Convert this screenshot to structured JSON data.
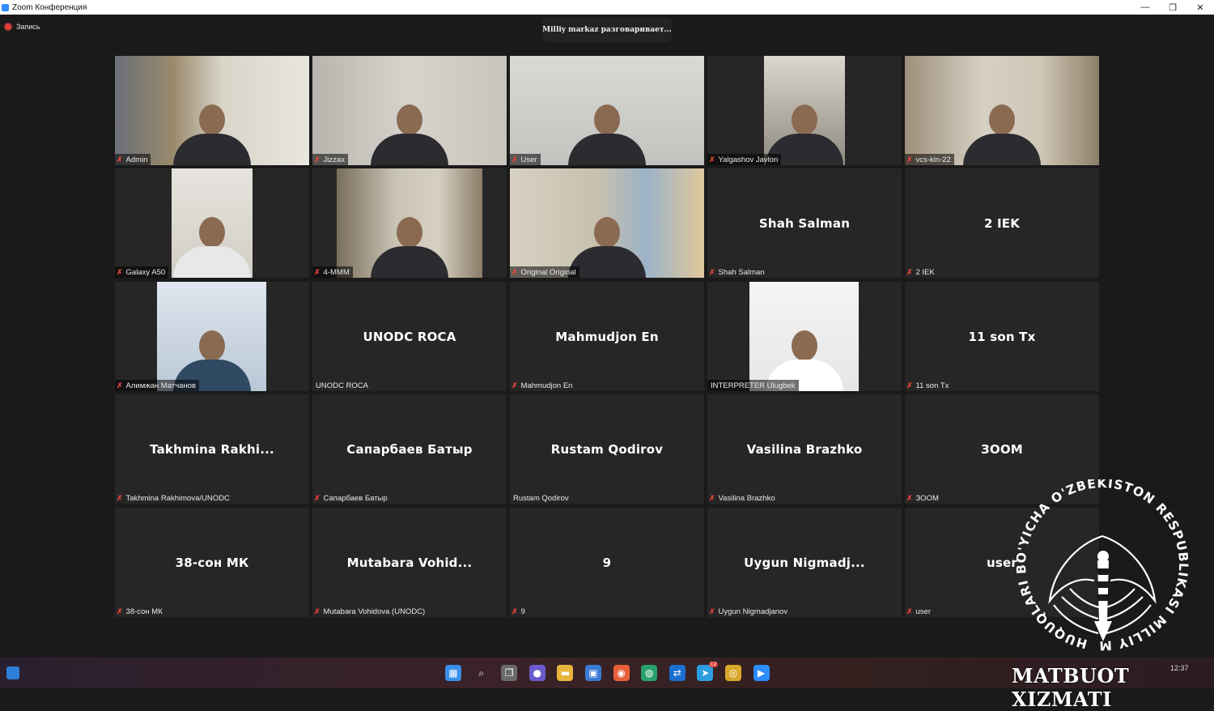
{
  "window": {
    "title": "Zoom Конференция",
    "minimize": "—",
    "restore": "❐",
    "close": "✕"
  },
  "recording": {
    "label": "Запись"
  },
  "speaking_indicator": "Milliy markaz разговаривает...",
  "tiles": [
    {
      "label": "Admin",
      "muted": true,
      "video": true,
      "center": ""
    },
    {
      "label": "Jizzax",
      "muted": true,
      "video": true,
      "center": ""
    },
    {
      "label": "User",
      "muted": true,
      "video": true,
      "center": ""
    },
    {
      "label": "Yalgashov Javlon",
      "muted": true,
      "video": true,
      "center": ""
    },
    {
      "label": "vcs-kin-22",
      "muted": true,
      "video": true,
      "center": ""
    },
    {
      "label": "Galaxy A50",
      "muted": true,
      "video": true,
      "center": ""
    },
    {
      "label": "4-MMM",
      "muted": true,
      "video": true,
      "center": ""
    },
    {
      "label": "Original Original",
      "muted": true,
      "video": true,
      "center": ""
    },
    {
      "label": "Shah Salman",
      "muted": true,
      "video": false,
      "center": "Shah Salman"
    },
    {
      "label": "2 IEK",
      "muted": true,
      "video": false,
      "center": "2 IEK"
    },
    {
      "label": "Алимжан Матчанов",
      "muted": true,
      "video": true,
      "center": ""
    },
    {
      "label": "UNODC ROCA",
      "muted": false,
      "video": false,
      "center": "UNODC ROCA"
    },
    {
      "label": "Mahmudjon En",
      "muted": true,
      "video": false,
      "center": "Mahmudjon En"
    },
    {
      "label": "INTERPRETER Ulugbek",
      "muted": false,
      "video": true,
      "center": ""
    },
    {
      "label": "11 son Tx",
      "muted": true,
      "video": false,
      "center": "11 son Tx"
    },
    {
      "label": "Takhmina Rakhimova/UNODC",
      "muted": true,
      "video": false,
      "center": "Takhmina  Rakhi..."
    },
    {
      "label": "Сапарбаев Батыр",
      "muted": true,
      "video": false,
      "center": "Сапарбаев Батыр"
    },
    {
      "label": "Rustam Qodirov",
      "muted": false,
      "video": false,
      "center": "Rustam Qodirov"
    },
    {
      "label": "Vasilina Brazhko",
      "muted": true,
      "video": false,
      "center": "Vasilina Brazhko"
    },
    {
      "label": "ЗООМ",
      "muted": true,
      "video": false,
      "center": "ЗООМ"
    },
    {
      "label": "38-сон МК",
      "muted": true,
      "video": false,
      "center": "38-сон МК"
    },
    {
      "label": "Mutabara Vohidova (UNODC)",
      "muted": true,
      "video": false,
      "center": "Mutabara  Vohid..."
    },
    {
      "label": "9",
      "muted": true,
      "video": false,
      "center": "9"
    },
    {
      "label": "Uygun Nigmadjanov",
      "muted": true,
      "video": false,
      "center": "Uygun  Nigmadj..."
    },
    {
      "label": "user",
      "muted": true,
      "video": false,
      "center": "user"
    }
  ],
  "watermark": {
    "ring_text": "HUQUQLARI BO'YICHA O'ZBEKISTON RESPUBLIKASI MILLIY MARKAZI INSONI",
    "bottom_text": "MATBUOT XIZMATI"
  },
  "taskbar": {
    "icons": [
      "windows-start",
      "search",
      "task-view",
      "teams-chat",
      "file-explorer",
      "store",
      "firefox",
      "edge",
      "teamviewer",
      "telegram",
      "chrome",
      "zoom"
    ],
    "telegram_badge": "12",
    "time": "12:37"
  },
  "colors": {
    "tile_bg": "#262626",
    "page_bg": "#1a1a1a",
    "mute_red": "#e5453b",
    "rec_red": "#e0403a"
  }
}
